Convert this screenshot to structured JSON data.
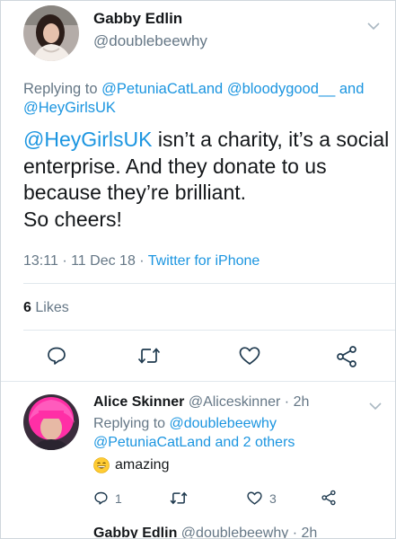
{
  "tweet": {
    "author_name": "Gabby Edlin",
    "author_handle": "@doublebeewhy",
    "replying_prefix": "Replying to ",
    "reply_mentions": [
      "@PetuniaCatLand",
      "@bloodygood__",
      "@HeyGirlsUK"
    ],
    "reply_and": "and",
    "text_mention": "@HeyGirlsUK",
    "text_body": " isn’t a charity, it’s a social enterprise. And they donate to us because they’re brilliant.",
    "text_line2": "So cheers!",
    "time": "13:11",
    "date": "11 Dec 18",
    "separator": "·",
    "source": "Twitter for iPhone",
    "likes_count": "6",
    "likes_label": "Likes"
  },
  "reply": {
    "author_name": "Alice Skinner",
    "author_handle": "@Aliceskinner",
    "age": "2h",
    "separator": "·",
    "replying_prefix": "Replying to ",
    "mention1": "@doublebeewhy",
    "mention2": "@PetuniaCatLand",
    "others": "and 2 others",
    "text": "amazing",
    "reply_count": "1",
    "like_count": "3"
  },
  "next_tweet": {
    "author_name": "Gabby Edlin",
    "author_handle": "@doublebeewhy",
    "separator": "·",
    "age": "2h"
  },
  "colors": {
    "link": "#1b95e0",
    "secondary_text": "#657786",
    "primary_text": "#14171a",
    "divider": "#e1e8ed"
  },
  "icons": [
    "chevron-down-icon",
    "reply-icon",
    "retweet-icon",
    "like-icon",
    "share-icon",
    "grinning-face-emoji"
  ]
}
